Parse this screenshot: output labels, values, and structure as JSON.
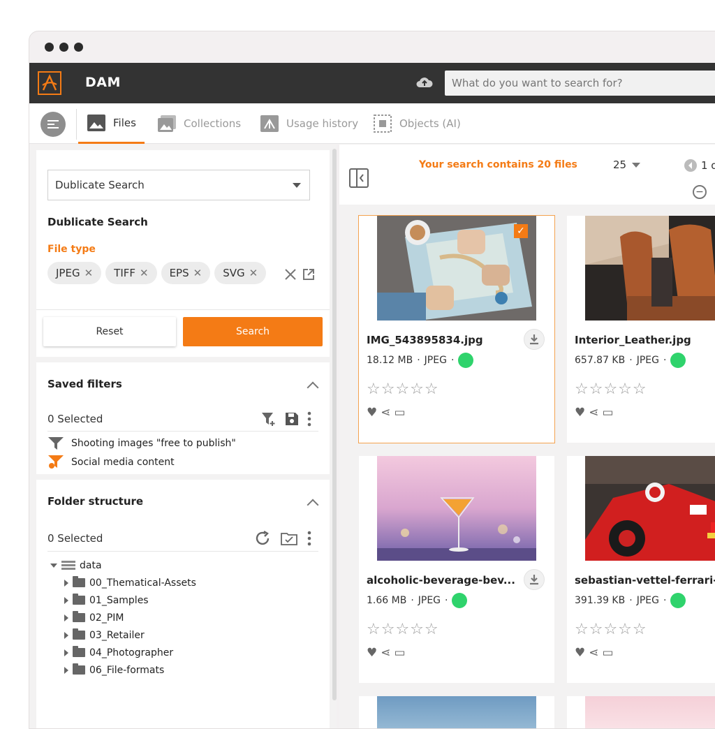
{
  "app": {
    "title": "DAM",
    "logo_icon": "logo-a-icon",
    "accent": "#f47b15"
  },
  "search": {
    "placeholder": "What do you want to search for?"
  },
  "tabs": [
    {
      "label": "Files",
      "icon": "image-icon",
      "active": true
    },
    {
      "label": "Collections",
      "icon": "collections-icon",
      "active": false
    },
    {
      "label": "Usage history",
      "icon": "usage-icon",
      "active": false
    },
    {
      "label": "Objects (AI)",
      "icon": "objects-ai-icon",
      "active": false
    }
  ],
  "filter": {
    "select_value": "Dublicate Search",
    "heading": "Dublicate Search",
    "file_type_label": "File type",
    "chips": [
      "JPEG",
      "TIFF",
      "EPS",
      "SVG"
    ],
    "reset_label": "Reset",
    "search_label": "Search"
  },
  "saved_filters": {
    "title": "Saved filters",
    "selected": "0 Selected",
    "items": [
      {
        "label": "Shooting images \"free to publish\"",
        "icon": "filter-icon"
      },
      {
        "label": "Social media content",
        "icon": "filter-shared-icon"
      }
    ]
  },
  "folders": {
    "title": "Folder structure",
    "selected": "0 Selected",
    "root": "data",
    "items": [
      "00_Thematical-Assets",
      "01_Samples",
      "02_PIM",
      "03_Retailer",
      "04_Photographer",
      "06_File-formats"
    ]
  },
  "results": {
    "summary": "Your search contains 20 files",
    "per_page": "25",
    "page": "1 o"
  },
  "files": [
    {
      "name": "IMG_543895834.jpg",
      "size": "18.12 MB",
      "type": "JPEG",
      "status_color": "#2fd36c",
      "selected": true,
      "rating": 0
    },
    {
      "name": "Interior_Leather.jpg",
      "size": "657.87 KB",
      "type": "JPEG",
      "status_color": "#2fd36c",
      "selected": false,
      "rating": 0
    },
    {
      "name": "alcoholic-beverage-bev...",
      "size": "1.66 MB",
      "type": "JPEG",
      "status_color": "#2fd36c",
      "selected": false,
      "rating": 0
    },
    {
      "name": "sebastian-vettel-ferrari-f",
      "size": "391.39 KB",
      "type": "JPEG",
      "status_color": "#2fd36c",
      "selected": false,
      "rating": 0
    }
  ]
}
